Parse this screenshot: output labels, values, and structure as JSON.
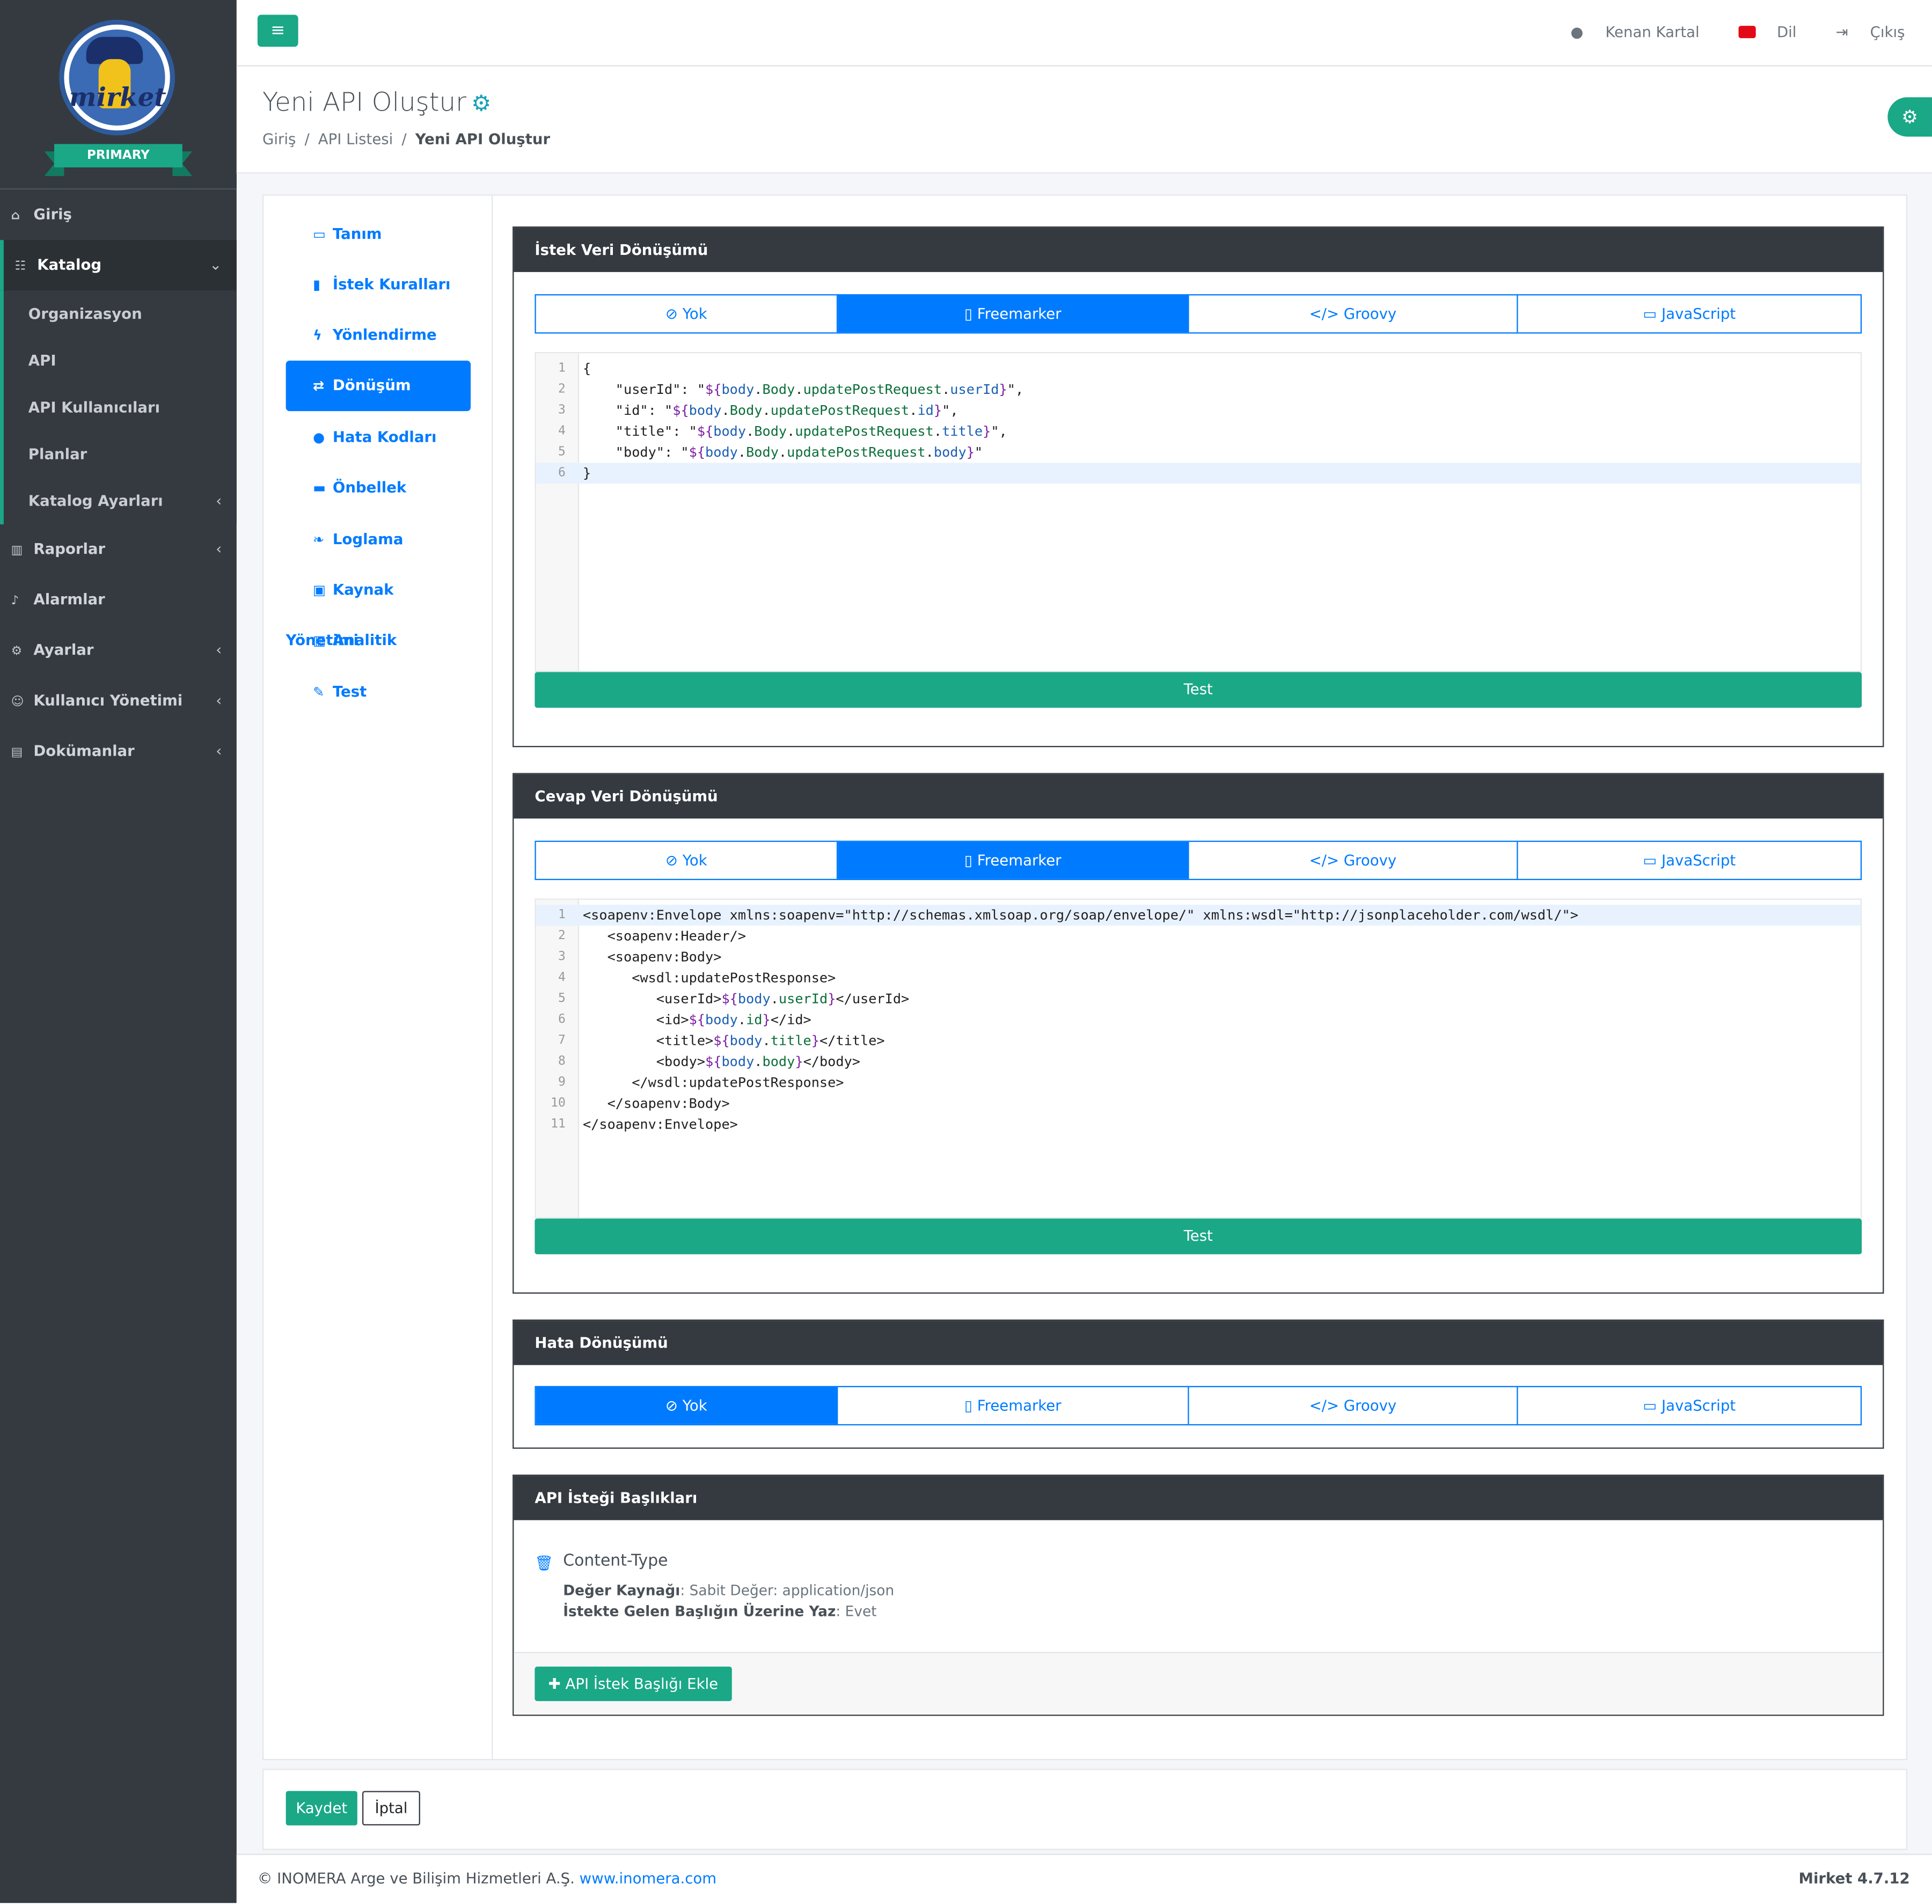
{
  "sidebar": {
    "brand_text": "mirket",
    "edition": "PRIMARY",
    "items": [
      {
        "label": "Giriş",
        "icon": "home-icon"
      },
      {
        "label": "Katalog",
        "icon": "sitemap-icon"
      },
      {
        "label": "Raporlar",
        "icon": "chart-icon"
      },
      {
        "label": "Alarmlar",
        "icon": "bell-icon"
      },
      {
        "label": "Ayarlar",
        "icon": "gears-icon"
      },
      {
        "label": "Kullanıcı Yönetimi",
        "icon": "users-icon"
      },
      {
        "label": "Dokümanlar",
        "icon": "document-icon"
      }
    ],
    "catalog_sub": [
      {
        "label": "Organizasyon"
      },
      {
        "label": "API"
      },
      {
        "label": "API Kullanıcıları"
      },
      {
        "label": "Planlar"
      },
      {
        "label": "Katalog Ayarları"
      }
    ]
  },
  "topbar": {
    "user": "Kenan Kartal",
    "language": "Dil",
    "logout": "Çıkış"
  },
  "header": {
    "title": "Yeni API Oluştur",
    "breadcrumb": [
      "Giriş",
      "API Listesi",
      "Yeni API Oluştur"
    ]
  },
  "tabs": [
    {
      "label": "Tanım",
      "icon": "id-card-icon"
    },
    {
      "label": "İstek Kuralları",
      "icon": "file-icon"
    },
    {
      "label": "Yönlendirme",
      "icon": "bolt-icon"
    },
    {
      "label": "Dönüşüm",
      "icon": "exchange-icon"
    },
    {
      "label": "Hata Kodları",
      "icon": "exclamation-icon"
    },
    {
      "label": "Önbellek",
      "icon": "memory-icon"
    },
    {
      "label": "Loglama",
      "icon": "leaf-icon"
    },
    {
      "label": "Kaynak Yönetimi",
      "icon": "lock-icon"
    },
    {
      "label": "Analitik",
      "icon": "chart-icon"
    },
    {
      "label": "Test",
      "icon": "pencil-icon"
    }
  ],
  "active_tab": "Dönüşüm",
  "transform_options": [
    "Yok",
    "Freemarker",
    "Groovy",
    "JavaScript"
  ],
  "request_transform": {
    "title": "İstek Veri Dönüşümü",
    "selected": "Freemarker",
    "line_numbers": [
      "1",
      "2",
      "3",
      "4",
      "5",
      "6"
    ],
    "test_label": "Test"
  },
  "response_transform": {
    "title": "Cevap Veri Dönüşümü",
    "selected": "Freemarker",
    "line_numbers": [
      "1",
      "2",
      "3",
      "4",
      "5",
      "6",
      "7",
      "8",
      "9",
      "10",
      "11"
    ],
    "test_label": "Test"
  },
  "error_transform": {
    "title": "Hata Dönüşümü",
    "selected": "Yok"
  },
  "headers_panel": {
    "title": "API İsteği Başlıkları",
    "header_name": "Content-Type",
    "source_label": "Değer Kaynağı",
    "source_value": "Sabit Değer: application/json",
    "override_label": "İstekte Gelen Başlığın Üzerine Yaz",
    "override_value": "Evet",
    "add_label": "API İstek Başlığı Ekle"
  },
  "actions": {
    "save": "Kaydet",
    "cancel": "İptal"
  },
  "footer": {
    "copyright": "© INOMERA Arge ve Bilişim Hizmetleri A.Ş.",
    "link": "www.inomera.com",
    "version": "Mirket 4.7.12"
  },
  "colors": {
    "sidebar": "#343a40",
    "accent_green": "#1aa887",
    "primary_blue": "#007bff",
    "panel_header": "#343a40"
  }
}
